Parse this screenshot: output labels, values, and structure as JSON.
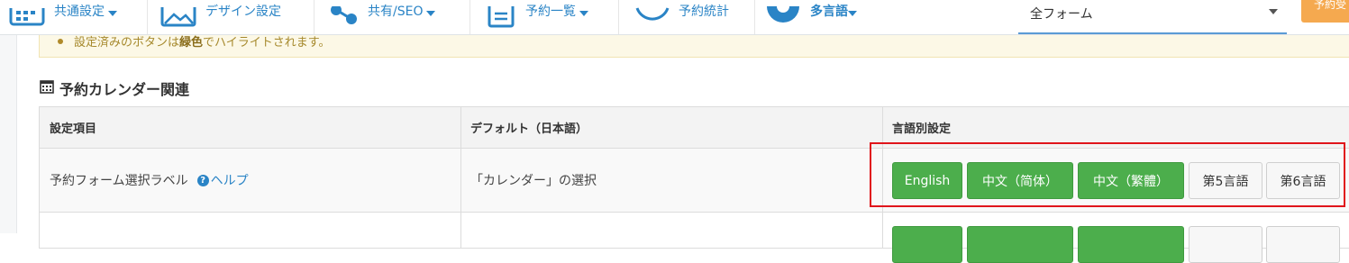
{
  "nav": {
    "items": [
      {
        "label": "共通設定",
        "icon": "calendar-grid-icon"
      },
      {
        "label": "デザイン設定",
        "icon": "image-icon"
      },
      {
        "label": "共有/SEO",
        "icon": "share-icon"
      },
      {
        "label": "予約一覧",
        "icon": "document-list-icon"
      },
      {
        "label": "予約統計",
        "icon": "refresh-icon"
      },
      {
        "label": "多言語",
        "icon": "gear-icon"
      }
    ],
    "form_select_value": "全フォーム",
    "orange_button_label": "予約受"
  },
  "notice": {
    "text_before": "設定済みのボタンは",
    "text_bold": "緑色",
    "text_after": "でハイライトされます。"
  },
  "section": {
    "title": "予約カレンダー関連",
    "icon": "calendar-icon"
  },
  "table": {
    "headers": [
      "設定項目",
      "デフォルト（日本語）",
      "言語別設定"
    ],
    "row1": {
      "item": "予約フォーム選択ラベル",
      "help": "ヘルプ",
      "default": "「カレンダー」の選択"
    }
  },
  "language_buttons": [
    {
      "label": "English",
      "state": "set"
    },
    {
      "label": "中文（简体）",
      "state": "set"
    },
    {
      "label": "中文（繁體）",
      "state": "set"
    },
    {
      "label": "第5言語",
      "state": "unset"
    },
    {
      "label": "第6言語",
      "state": "unset"
    }
  ],
  "colors": {
    "accent": "#2a84c6",
    "set_button": "#4cae4c",
    "highlight": "#e0151b",
    "notice_bg": "#fcf8e6",
    "orange": "#f5a94f"
  }
}
